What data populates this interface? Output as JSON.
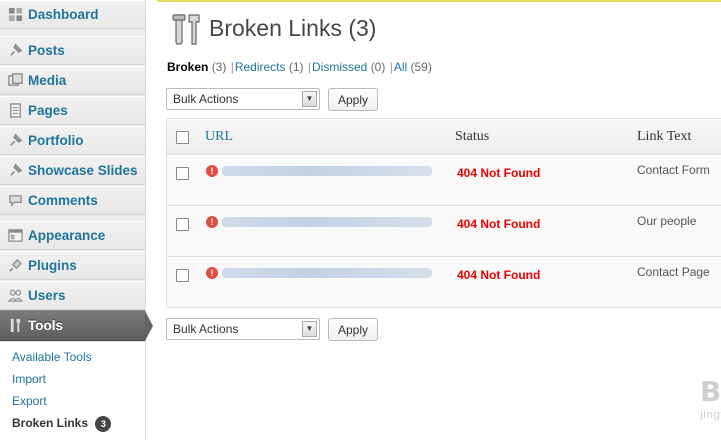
{
  "sidebar": {
    "items": [
      {
        "label": "Dashboard",
        "icon": "dashboard-icon"
      },
      {
        "label": "Posts",
        "icon": "pin-icon"
      },
      {
        "label": "Media",
        "icon": "media-icon"
      },
      {
        "label": "Pages",
        "icon": "pages-icon"
      },
      {
        "label": "Portfolio",
        "icon": "pin-icon"
      },
      {
        "label": "Showcase Slides",
        "icon": "pin-icon"
      },
      {
        "label": "Comments",
        "icon": "comments-icon"
      },
      {
        "label": "Appearance",
        "icon": "appearance-icon"
      },
      {
        "label": "Plugins",
        "icon": "plugins-icon"
      },
      {
        "label": "Users",
        "icon": "users-icon"
      },
      {
        "label": "Tools",
        "icon": "tools-icon"
      }
    ],
    "submenu": [
      {
        "label": "Available Tools"
      },
      {
        "label": "Import"
      },
      {
        "label": "Export"
      },
      {
        "label": "Broken Links",
        "badge": "3"
      }
    ]
  },
  "page": {
    "title": "Broken Links (3)"
  },
  "filters": {
    "broken": "Broken",
    "broken_count": "(3)",
    "redirects": "Redirects",
    "redirects_count": "(1)",
    "dismissed": "Dismissed",
    "dismissed_count": "(0)",
    "all": "All",
    "all_count": "(59)"
  },
  "bulk": {
    "select_top": "Bulk Actions",
    "apply_top": "Apply",
    "select_bottom": "Bulk Actions",
    "apply_bottom": "Apply"
  },
  "table": {
    "columns": [
      "URL",
      "Status",
      "Link Text"
    ],
    "rows": [
      {
        "status": "404 Not Found",
        "link_text": "Contact Form"
      },
      {
        "status": "404 Not Found",
        "link_text": "Our people"
      },
      {
        "status": "404 Not Found",
        "link_text": "Contact Page"
      }
    ]
  },
  "watermark": {
    "logo": "Baidu经验",
    "url": "jingyan.baidu.com"
  },
  "colors": {
    "link": "#21759b",
    "error": "#e00000",
    "current_menu": "#646464"
  }
}
